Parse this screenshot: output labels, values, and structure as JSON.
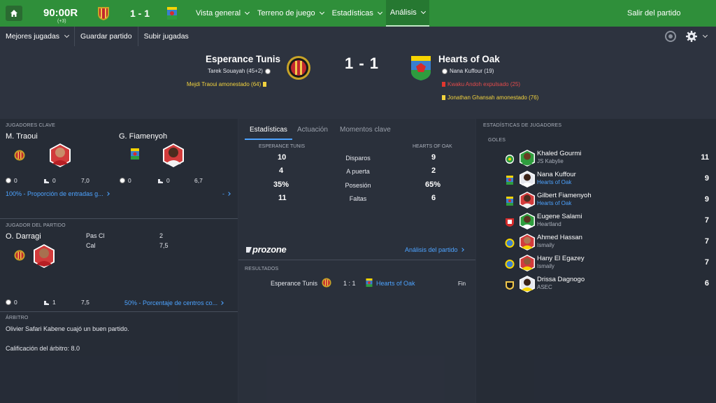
{
  "topbar": {
    "clock": "90:00R",
    "added_time": "(+3)",
    "score": "1 - 1",
    "nav": [
      "Vista general",
      "Terreno de juego",
      "Estadísticas",
      "Análisis"
    ],
    "exit": "Salir del partido"
  },
  "subbar": {
    "best_plays": "Mejores jugadas",
    "save_match": "Guardar partido",
    "upload_plays": "Subir jugadas"
  },
  "header": {
    "home_team": "Esperance Tunis",
    "away_team": "Hearts of Oak",
    "score": "1 - 1",
    "home_events": [
      {
        "text": "Tarek Souayah (45+2)",
        "type": "goal"
      },
      {
        "text": "Mejdi Traoui amonestado (64)",
        "type": "yellow"
      }
    ],
    "away_events": [
      {
        "text": "Nana Kuffour (19)",
        "type": "goal"
      },
      {
        "text": "Kwaku Andoh expulsado (25)",
        "type": "red"
      },
      {
        "text": "Jonathan Ghansah amonestado (76)",
        "type": "yellow"
      }
    ]
  },
  "key_players": {
    "title": "JUGADORES CLAVE",
    "p1": {
      "name": "M. Traoui",
      "goals": "0",
      "assists": "0",
      "rating": "7,0"
    },
    "p2": {
      "name": "G. Fiamenyoh",
      "goals": "0",
      "assists": "0",
      "rating": "6,7"
    },
    "link_left": "100% - Proporción de entradas g...",
    "link_right": "-"
  },
  "potm": {
    "title": "JUGADOR DEL PARTIDO",
    "name": "O. Darragi",
    "k1": "Pas Cl",
    "v1": "2",
    "k2": "Cal",
    "v2": "7,5",
    "goals": "0",
    "assists": "1",
    "rating": "7,5",
    "link": "50% - Porcentaje de centros co..."
  },
  "referee": {
    "title": "ÁRBITRO",
    "line1": "Olivier Safari Kabene cuajó un buen partido.",
    "line2": "Calificación del árbitro: 8.0"
  },
  "middle": {
    "tabs": [
      "Estadísticas",
      "Actuación",
      "Momentos clave"
    ],
    "home_head": "ESPERANCE TUNIS",
    "away_head": "HEARTS OF OAK",
    "rows": [
      {
        "home": "10",
        "label": "Disparos",
        "away": "9"
      },
      {
        "home": "4",
        "label": "A puerta",
        "away": "2"
      },
      {
        "home": "35%",
        "label": "Posesión",
        "away": "65%"
      },
      {
        "home": "11",
        "label": "Faltas",
        "away": "6"
      }
    ],
    "prozone": "prozone",
    "analysis_link": "Análisis del partido",
    "results_title": "RESULTADOS",
    "result": {
      "home": "Esperance Tunis",
      "score": "1 : 1",
      "away": "Hearts of Oak",
      "status": "Fin"
    }
  },
  "right": {
    "title": "ESTADÍSTICAS DE JUGADORES",
    "goals_title": "GOLES",
    "scorers": [
      {
        "name": "Khaled Gourmi",
        "club": "JS Kabylie",
        "goals": "11",
        "club_link": false
      },
      {
        "name": "Nana Kuffour",
        "club": "Hearts of Oak",
        "goals": "9",
        "club_link": true
      },
      {
        "name": "Gilbert Fiamenyoh",
        "club": "Hearts of Oak",
        "goals": "9",
        "club_link": true
      },
      {
        "name": "Eugene Salami",
        "club": "Heartland",
        "goals": "7",
        "club_link": false
      },
      {
        "name": "Ahmed Hassan",
        "club": "Ismaily",
        "goals": "7",
        "club_link": false
      },
      {
        "name": "Hany El Egazey",
        "club": "Ismaily",
        "goals": "7",
        "club_link": false
      },
      {
        "name": "Drissa Dagnogo",
        "club": "ASEC",
        "goals": "6",
        "club_link": false
      }
    ]
  },
  "colors": {
    "topbar": "#2f8f3a",
    "link": "#4da3ff",
    "yellow_card": "#f1d23e",
    "red_card": "#e0372f"
  }
}
